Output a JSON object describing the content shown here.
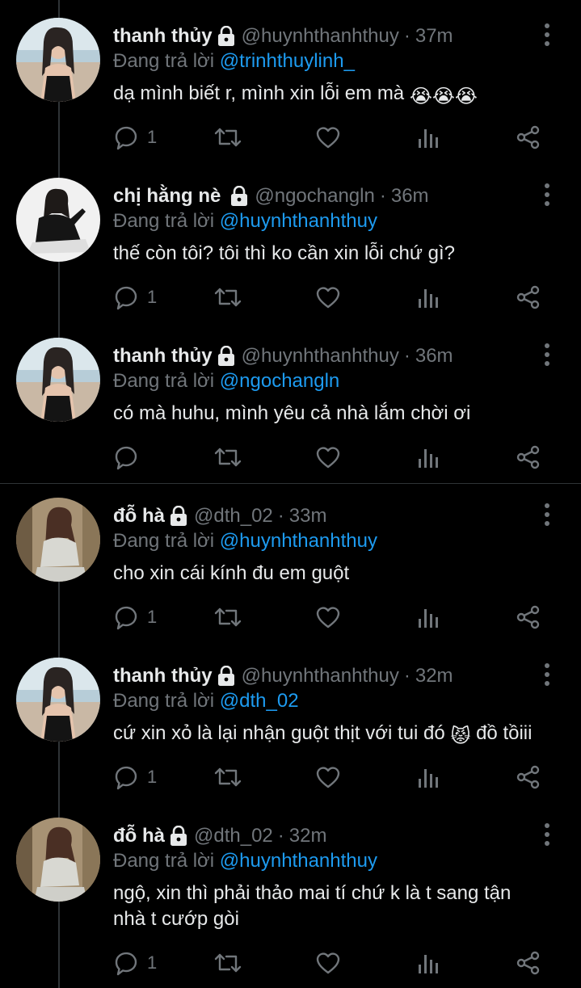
{
  "tweets": [
    {
      "name": "thanh thủy",
      "handle": "@huynhthanhthuy",
      "time": "37m",
      "reply_prefix": "Đang trả lời",
      "reply_to": "@trinhthuylinh_",
      "text": "dạ mình biết r, mình xin lỗi em mà",
      "emoji": "😭😭😭",
      "reply_count": "1",
      "avatar": "beach-girl-avatar"
    },
    {
      "name": "chị hằng nè",
      "handle": "@ngochangln",
      "time": "36m",
      "reply_prefix": "Đang trả lời",
      "reply_to": "@huynhthanhthuy",
      "text": "thế còn tôi? tôi thì ko cần xin lỗi chứ gì?",
      "reply_count": "1",
      "avatar": "sitting-girl-avatar"
    },
    {
      "name": "thanh thủy",
      "handle": "@huynhthanhthuy",
      "time": "36m",
      "reply_prefix": "Đang trả lời",
      "reply_to": "@ngochangln",
      "text": "có mà huhu, mình yêu cả nhà lắm chời ơi",
      "reply_count": "",
      "avatar": "beach-girl-avatar"
    },
    {
      "name": "đỗ hà",
      "handle": "@dth_02",
      "time": "33m",
      "reply_prefix": "Đang trả lời",
      "reply_to": "@huynhthanhthuy",
      "text": "cho xin cái kính đu em guột",
      "reply_count": "1",
      "avatar": "indoor-girl-avatar"
    },
    {
      "name": "thanh thủy",
      "handle": "@huynhthanhthuy",
      "time": "32m",
      "reply_prefix": "Đang trả lời",
      "reply_to": "@dth_02",
      "text_before": "cứ xin xỏ là lại nhận guột thịt với tui đó",
      "emoji": "😾",
      "text_after": "đồ tồiii",
      "reply_count": "1",
      "avatar": "beach-girl-avatar"
    },
    {
      "name": "đỗ hà",
      "handle": "@dth_02",
      "time": "32m",
      "reply_prefix": "Đang trả lời",
      "reply_to": "@huynhthanhthuy",
      "text_line1": "ngộ, xin thì phải thảo mai tí chứ k là t sang tận",
      "text_line2": "nhà t cướp gòi",
      "reply_count": "1",
      "avatar": "indoor-girl-avatar"
    }
  ],
  "colors": {
    "background": "#000000",
    "text": "#e7e9ea",
    "muted": "#71767b",
    "mention": "#1d9bf0",
    "divider": "#2f3336"
  },
  "icons": [
    "lock-icon",
    "more-options-icon",
    "reply-icon",
    "retweet-icon",
    "like-icon",
    "views-icon",
    "share-icon"
  ]
}
